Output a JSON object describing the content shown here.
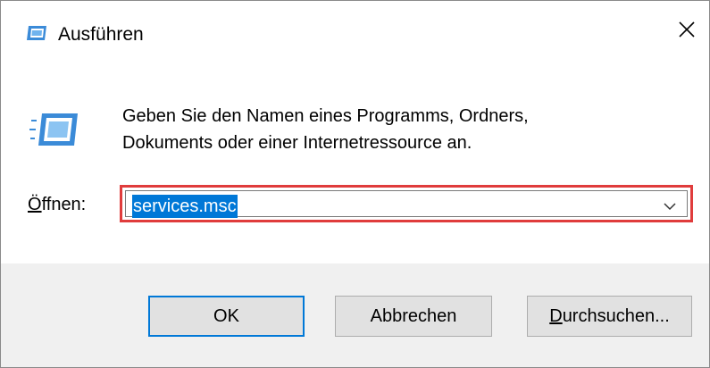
{
  "window": {
    "title": "Ausführen",
    "close_glyph": "✕"
  },
  "dialog": {
    "description_line1": "Geben Sie den Namen eines Programms, Ordners,",
    "description_line2": "Dokuments oder einer Internetressource an.",
    "open_label_accel": "Ö",
    "open_label_rest": "ffnen:",
    "open_value": "services.msc"
  },
  "buttons": {
    "ok": "OK",
    "cancel": "Abbrechen",
    "browse_accel": "D",
    "browse_rest": "urchsuchen..."
  },
  "icons": {
    "title": "run-icon",
    "main": "run-icon",
    "close": "close-icon",
    "dropdown": "chevron-down-icon"
  },
  "colors": {
    "highlight": "#e03c3c",
    "selection": "#0078d7",
    "footer": "#f0f0f0"
  }
}
